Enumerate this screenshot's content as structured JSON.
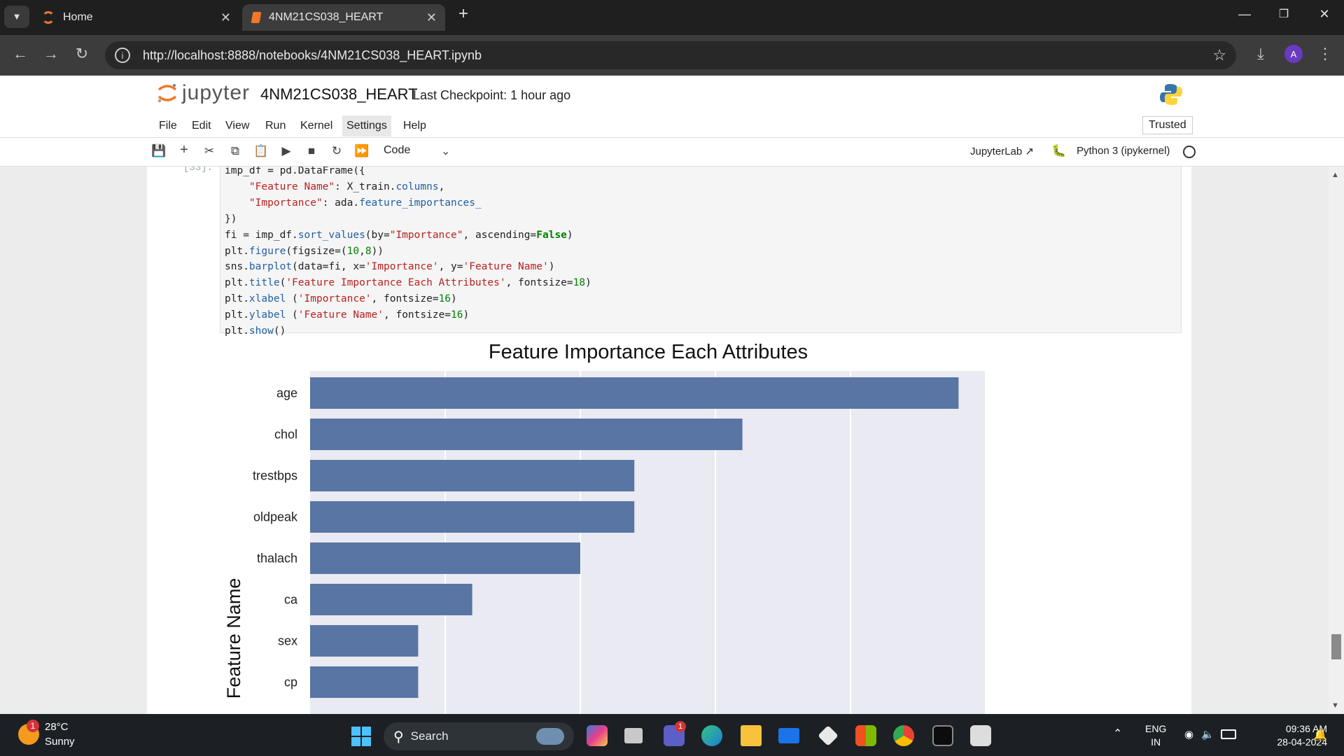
{
  "browser": {
    "tabs": [
      {
        "title": "Home",
        "active": false
      },
      {
        "title": "4NM21CS038_HEART",
        "active": true
      }
    ],
    "url": "http://localhost:8888/notebooks/4NM21CS038_HEART.ipynb",
    "avatar_letter": "A"
  },
  "jupyter": {
    "logo_text": "jupyter",
    "notebook_name": "4NM21CS038_HEART",
    "checkpoint": "Last Checkpoint: 1 hour ago",
    "menus": [
      "File",
      "Edit",
      "View",
      "Run",
      "Kernel",
      "Settings",
      "Help"
    ],
    "trusted_label": "Trusted",
    "cell_type": "Code",
    "jupyterlab_link": "JupyterLab",
    "kernel_name": "Python 3 (ipykernel)"
  },
  "cell": {
    "prompt": "[33]:",
    "code_lines": [
      "imp_df = pd.DataFrame({",
      "    \"Feature Name\": X_train.columns,",
      "    \"Importance\": ada.feature_importances_",
      "})",
      "fi = imp_df.sort_values(by=\"Importance\", ascending=False)",
      "plt.figure(figsize=(10,8))",
      "sns.barplot(data=fi, x='Importance', y='Feature Name')",
      "plt.title('Feature Importance Each Attributes', fontsize=18)",
      "plt.xlabel ('Importance', fontsize=16)",
      "plt.ylabel ('Feature Name', fontsize=16)",
      "plt.show()"
    ]
  },
  "chart_data": {
    "type": "bar",
    "orientation": "horizontal",
    "title": "Feature Importance Each Attributes",
    "ylabel": "Feature Name",
    "xlabel": "",
    "categories": [
      "age",
      "chol",
      "trestbps",
      "oldpeak",
      "thalach",
      "ca",
      "sex",
      "cp"
    ],
    "values": [
      0.24,
      0.16,
      0.12,
      0.12,
      0.1,
      0.06,
      0.04,
      0.04
    ],
    "xlim": [
      0,
      0.25
    ],
    "bar_color": "#5875a4",
    "plot_background": "#eaeaf2",
    "grid": true
  },
  "taskbar": {
    "temperature": "28°C",
    "condition": "Sunny",
    "weather_badge": "1",
    "search_label": "Search",
    "language": "ENG",
    "region": "IN",
    "time": "09:36 AM",
    "date": "28-04-2024",
    "teams_badge": "1"
  }
}
